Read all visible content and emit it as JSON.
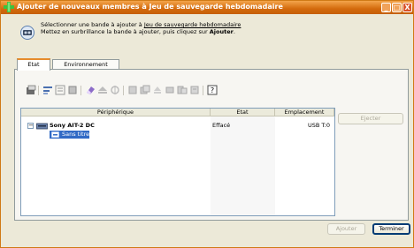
{
  "window": {
    "title": "Ajouter de nouveaux membres à Jeu de sauvegarde hebdomadaire",
    "minimize": "_",
    "maximize": "□",
    "close": "X"
  },
  "instructions": {
    "line1_prefix": "Sélectionner une bande à ajouter à ",
    "line1_link": "Jeu de sauvegarde hebdomadaire",
    "line2_prefix": "Mettez en surbrillance la bande à ajouter, puis cliquez sur ",
    "line2_bold": "Ajouter",
    "line2_suffix": "."
  },
  "tabs": [
    {
      "label": "Etat",
      "active": true
    },
    {
      "label": "Environnement",
      "active": false
    }
  ],
  "toolbar": {
    "icons": [
      "properties-icon",
      "format-icon",
      "catalog-icon",
      "inventory-icon",
      "erase-icon",
      "eject-icon",
      "import-icon",
      "disabled-icon-1",
      "disabled-icon-2",
      "disabled-icon-3",
      "disabled-icon-4",
      "disabled-icon-5",
      "disabled-icon-6",
      "help-icon"
    ]
  },
  "table": {
    "columns": [
      "Périphérique",
      "Etat",
      "Emplacement"
    ],
    "device": {
      "name": "Sony AIT-2 DC",
      "etat": "Effacé",
      "emplacement": "USB T:0"
    },
    "media": {
      "name": "Sans titre"
    },
    "expander": "−"
  },
  "buttons": {
    "eject": "Ejecter",
    "add": "Ajouter",
    "finish": "Terminer"
  },
  "colors": {
    "titlebar": "#d36a0c",
    "selection": "#316ac5",
    "tab_accent": "#e68b2c"
  }
}
